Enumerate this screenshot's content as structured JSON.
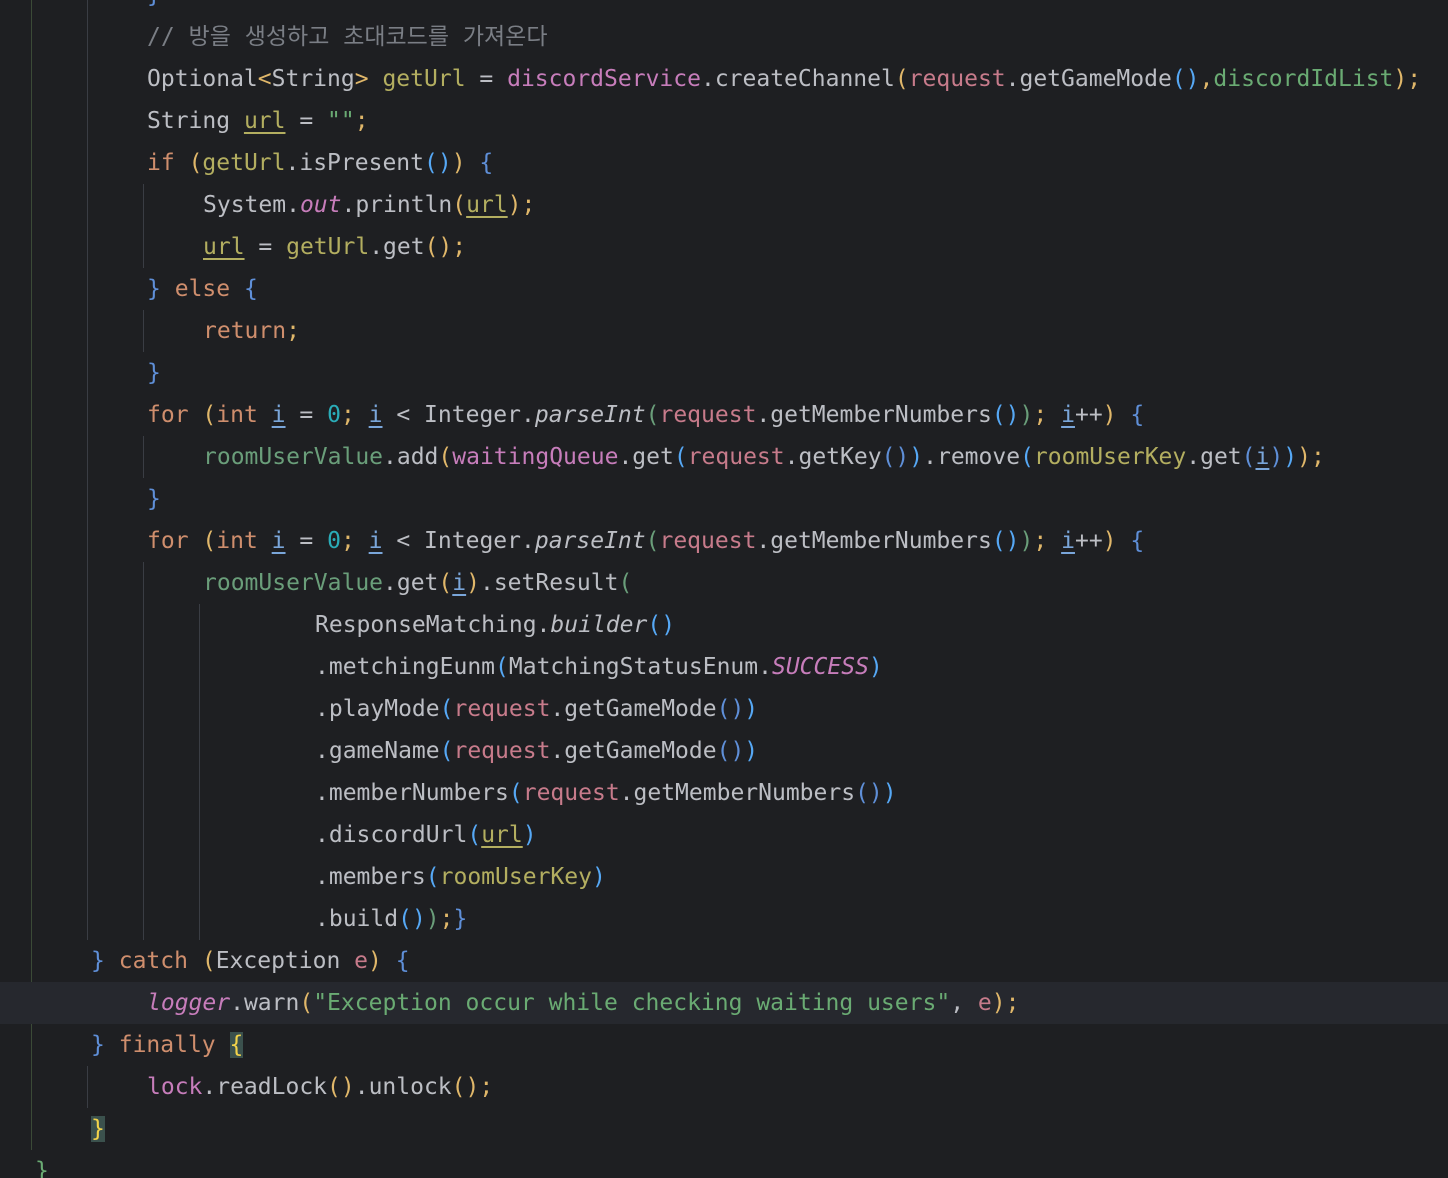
{
  "editor": {
    "language": "java",
    "theme_colors": {
      "background": "#1e1f22",
      "current_line": "#26282e",
      "keyword": "#cf8e6d",
      "string": "#6aab73",
      "number": "#2aacb8",
      "comment": "#7a7e85",
      "field": "#c77dbb",
      "parameter": "#c77b8b",
      "local_variable": "#b3ae60",
      "brace_match_bg": "#3b514d"
    },
    "current_line_index": 24,
    "lines": [
      {
        "tokens": [
          [
            "}",
            "p4"
          ]
        ]
      },
      {
        "tokens": [
          [
            "// 방을 생성하고 초대코드를 가져온다",
            "com"
          ]
        ]
      },
      {
        "tokens": [
          [
            "Optional",
            "plain"
          ],
          [
            "<",
            "gen"
          ],
          [
            "String",
            "plain"
          ],
          [
            ">",
            "gen"
          ],
          [
            " ",
            "plain"
          ],
          [
            "getUrl",
            "var"
          ],
          [
            " = ",
            "plain"
          ],
          [
            "discordService",
            "field"
          ],
          [
            ".createChannel",
            "plain"
          ],
          [
            "(",
            "gen"
          ],
          [
            "request",
            "param"
          ],
          [
            ".getGameMode",
            "plain"
          ],
          [
            "()",
            "p3"
          ],
          [
            ",",
            "gen"
          ],
          [
            "discordIdList",
            "str"
          ],
          [
            ")",
            "gen"
          ],
          [
            ";",
            "gen"
          ]
        ]
      },
      {
        "tokens": [
          [
            "String ",
            "plain"
          ],
          [
            "url",
            "reassign"
          ],
          [
            " = ",
            "plain"
          ],
          [
            "\"\"",
            "str"
          ],
          [
            ";",
            "gen"
          ]
        ]
      },
      {
        "tokens": [
          [
            "if",
            "kw"
          ],
          [
            " ",
            "plain"
          ],
          [
            "(",
            "gen"
          ],
          [
            "getUrl",
            "var"
          ],
          [
            ".isPresent",
            "plain"
          ],
          [
            "()",
            "p3"
          ],
          [
            ")",
            "gen"
          ],
          [
            " ",
            "plain"
          ],
          [
            "{",
            "p4"
          ]
        ]
      },
      {
        "tokens": [
          [
            "System.",
            "plain"
          ],
          [
            "out",
            "staticfield"
          ],
          [
            ".println",
            "plain"
          ],
          [
            "(",
            "gen"
          ],
          [
            "url",
            "reassign"
          ],
          [
            ")",
            "gen"
          ],
          [
            ";",
            "gen"
          ]
        ]
      },
      {
        "tokens": [
          [
            "url",
            "reassign"
          ],
          [
            " = ",
            "plain"
          ],
          [
            "getUrl",
            "var"
          ],
          [
            ".get",
            "plain"
          ],
          [
            "()",
            "gen"
          ],
          [
            ";",
            "gen"
          ]
        ]
      },
      {
        "tokens": [
          [
            "}",
            "p4"
          ],
          [
            " ",
            "plain"
          ],
          [
            "else",
            "kw"
          ],
          [
            " ",
            "plain"
          ],
          [
            "{",
            "p4"
          ]
        ]
      },
      {
        "tokens": [
          [
            "return",
            "kw"
          ],
          [
            ";",
            "gen"
          ]
        ]
      },
      {
        "tokens": [
          [
            "}",
            "p4"
          ]
        ]
      },
      {
        "tokens": [
          [
            "for",
            "kw"
          ],
          [
            " ",
            "plain"
          ],
          [
            "(",
            "gen"
          ],
          [
            "int",
            "kw"
          ],
          [
            " ",
            "plain"
          ],
          [
            "i",
            "lvar"
          ],
          [
            " = ",
            "plain"
          ],
          [
            "0",
            "num"
          ],
          [
            ";",
            "gen"
          ],
          [
            " ",
            "plain"
          ],
          [
            "i",
            "lvar"
          ],
          [
            " < Integer.",
            "plain"
          ],
          [
            "parseInt",
            "static"
          ],
          [
            "(",
            "fieldgreen"
          ],
          [
            "request",
            "param"
          ],
          [
            ".getMemberNumbers",
            "plain"
          ],
          [
            "()",
            "p3"
          ],
          [
            ")",
            "fieldgreen"
          ],
          [
            ";",
            "gen"
          ],
          [
            " ",
            "plain"
          ],
          [
            "i",
            "lvar"
          ],
          [
            "++",
            "plain"
          ],
          [
            ")",
            "gen"
          ],
          [
            " ",
            "plain"
          ],
          [
            "{",
            "p4"
          ]
        ]
      },
      {
        "tokens": [
          [
            "roomUserValue",
            "fieldgreen"
          ],
          [
            ".add",
            "plain"
          ],
          [
            "(",
            "gen"
          ],
          [
            "waitingQueue",
            "field"
          ],
          [
            ".get",
            "plain"
          ],
          [
            "(",
            "p3"
          ],
          [
            "request",
            "param"
          ],
          [
            ".getKey",
            "plain"
          ],
          [
            "()",
            "p4"
          ],
          [
            ")",
            "p3"
          ],
          [
            ".remove",
            "plain"
          ],
          [
            "(",
            "p3"
          ],
          [
            "roomUserKey",
            "var"
          ],
          [
            ".get",
            "plain"
          ],
          [
            "(",
            "p4"
          ],
          [
            "i",
            "lvar"
          ],
          [
            ")",
            "p4"
          ],
          [
            ")",
            "p3"
          ],
          [
            ")",
            "gen"
          ],
          [
            ";",
            "gen"
          ]
        ]
      },
      {
        "tokens": [
          [
            "}",
            "p4"
          ]
        ]
      },
      {
        "tokens": [
          [
            "for",
            "kw"
          ],
          [
            " ",
            "plain"
          ],
          [
            "(",
            "gen"
          ],
          [
            "int",
            "kw"
          ],
          [
            " ",
            "plain"
          ],
          [
            "i",
            "lvar"
          ],
          [
            " = ",
            "plain"
          ],
          [
            "0",
            "num"
          ],
          [
            ";",
            "gen"
          ],
          [
            " ",
            "plain"
          ],
          [
            "i",
            "lvar"
          ],
          [
            " < Integer.",
            "plain"
          ],
          [
            "parseInt",
            "static"
          ],
          [
            "(",
            "fieldgreen"
          ],
          [
            "request",
            "param"
          ],
          [
            ".getMemberNumbers",
            "plain"
          ],
          [
            "()",
            "p3"
          ],
          [
            ")",
            "fieldgreen"
          ],
          [
            ";",
            "gen"
          ],
          [
            " ",
            "plain"
          ],
          [
            "i",
            "lvar"
          ],
          [
            "++",
            "plain"
          ],
          [
            ")",
            "gen"
          ],
          [
            " ",
            "plain"
          ],
          [
            "{",
            "p4"
          ]
        ]
      },
      {
        "tokens": [
          [
            "roomUserValue",
            "fieldgreen"
          ],
          [
            ".get",
            "plain"
          ],
          [
            "(",
            "gen"
          ],
          [
            "i",
            "lvar"
          ],
          [
            ")",
            "gen"
          ],
          [
            ".setResult",
            "plain"
          ],
          [
            "(",
            "fieldgreen"
          ]
        ]
      },
      {
        "tokens": [
          [
            "ResponseMatching.",
            "plain"
          ],
          [
            "builder",
            "static"
          ],
          [
            "()",
            "p3"
          ]
        ]
      },
      {
        "tokens": [
          [
            ".metchingEunm",
            "plain"
          ],
          [
            "(",
            "p3"
          ],
          [
            "MatchingStatusEnum.",
            "plain"
          ],
          [
            "SUCCESS",
            "staticfield"
          ],
          [
            ")",
            "p3"
          ]
        ]
      },
      {
        "tokens": [
          [
            ".playMode",
            "plain"
          ],
          [
            "(",
            "p3"
          ],
          [
            "request",
            "param"
          ],
          [
            ".getGameMode",
            "plain"
          ],
          [
            "()",
            "p4"
          ],
          [
            ")",
            "p3"
          ]
        ]
      },
      {
        "tokens": [
          [
            ".gameName",
            "plain"
          ],
          [
            "(",
            "p3"
          ],
          [
            "request",
            "param"
          ],
          [
            ".getGameMode",
            "plain"
          ],
          [
            "()",
            "p4"
          ],
          [
            ")",
            "p3"
          ]
        ]
      },
      {
        "tokens": [
          [
            ".memberNumbers",
            "plain"
          ],
          [
            "(",
            "p3"
          ],
          [
            "request",
            "param"
          ],
          [
            ".getMemberNumbers",
            "plain"
          ],
          [
            "()",
            "p4"
          ],
          [
            ")",
            "p3"
          ]
        ]
      },
      {
        "tokens": [
          [
            ".discordUrl",
            "plain"
          ],
          [
            "(",
            "p3"
          ],
          [
            "url",
            "reassign"
          ],
          [
            ")",
            "p3"
          ]
        ]
      },
      {
        "tokens": [
          [
            ".members",
            "plain"
          ],
          [
            "(",
            "p3"
          ],
          [
            "roomUserKey",
            "var"
          ],
          [
            ")",
            "p3"
          ]
        ]
      },
      {
        "tokens": [
          [
            ".build",
            "plain"
          ],
          [
            "()",
            "p3"
          ],
          [
            ")",
            "fieldgreen"
          ],
          [
            ";",
            "gen"
          ],
          [
            "}",
            "p4"
          ]
        ]
      },
      {
        "tokens": [
          [
            "}",
            "p4"
          ],
          [
            " ",
            "plain"
          ],
          [
            "catch",
            "kw"
          ],
          [
            " ",
            "plain"
          ],
          [
            "(",
            "gen"
          ],
          [
            "Exception ",
            "plain"
          ],
          [
            "e",
            "param"
          ],
          [
            ")",
            "gen"
          ],
          [
            " ",
            "plain"
          ],
          [
            "{",
            "p4"
          ]
        ]
      },
      {
        "tokens": [
          [
            "logger",
            "logger"
          ],
          [
            ".warn",
            "plain"
          ],
          [
            "(",
            "gen"
          ],
          [
            "\"Exception occur while checking waiting users\"",
            "str"
          ],
          [
            ", ",
            "plain"
          ],
          [
            "e",
            "param"
          ],
          [
            ")",
            "gen"
          ],
          [
            ";",
            "gen"
          ]
        ]
      },
      {
        "tokens": [
          [
            "}",
            "p4"
          ],
          [
            " ",
            "plain"
          ],
          [
            "finally",
            "kw"
          ],
          [
            " ",
            "plain"
          ],
          [
            "{",
            "match"
          ]
        ]
      },
      {
        "tokens": [
          [
            "lock",
            "field"
          ],
          [
            ".readLock",
            "plain"
          ],
          [
            "()",
            "gen"
          ],
          [
            ".unlock",
            "plain"
          ],
          [
            "()",
            "gen"
          ],
          [
            ";",
            "gen"
          ]
        ]
      },
      {
        "tokens": [
          [
            "}",
            "match"
          ]
        ]
      },
      {
        "tokens": [
          [
            "}",
            "str"
          ]
        ]
      }
    ]
  }
}
